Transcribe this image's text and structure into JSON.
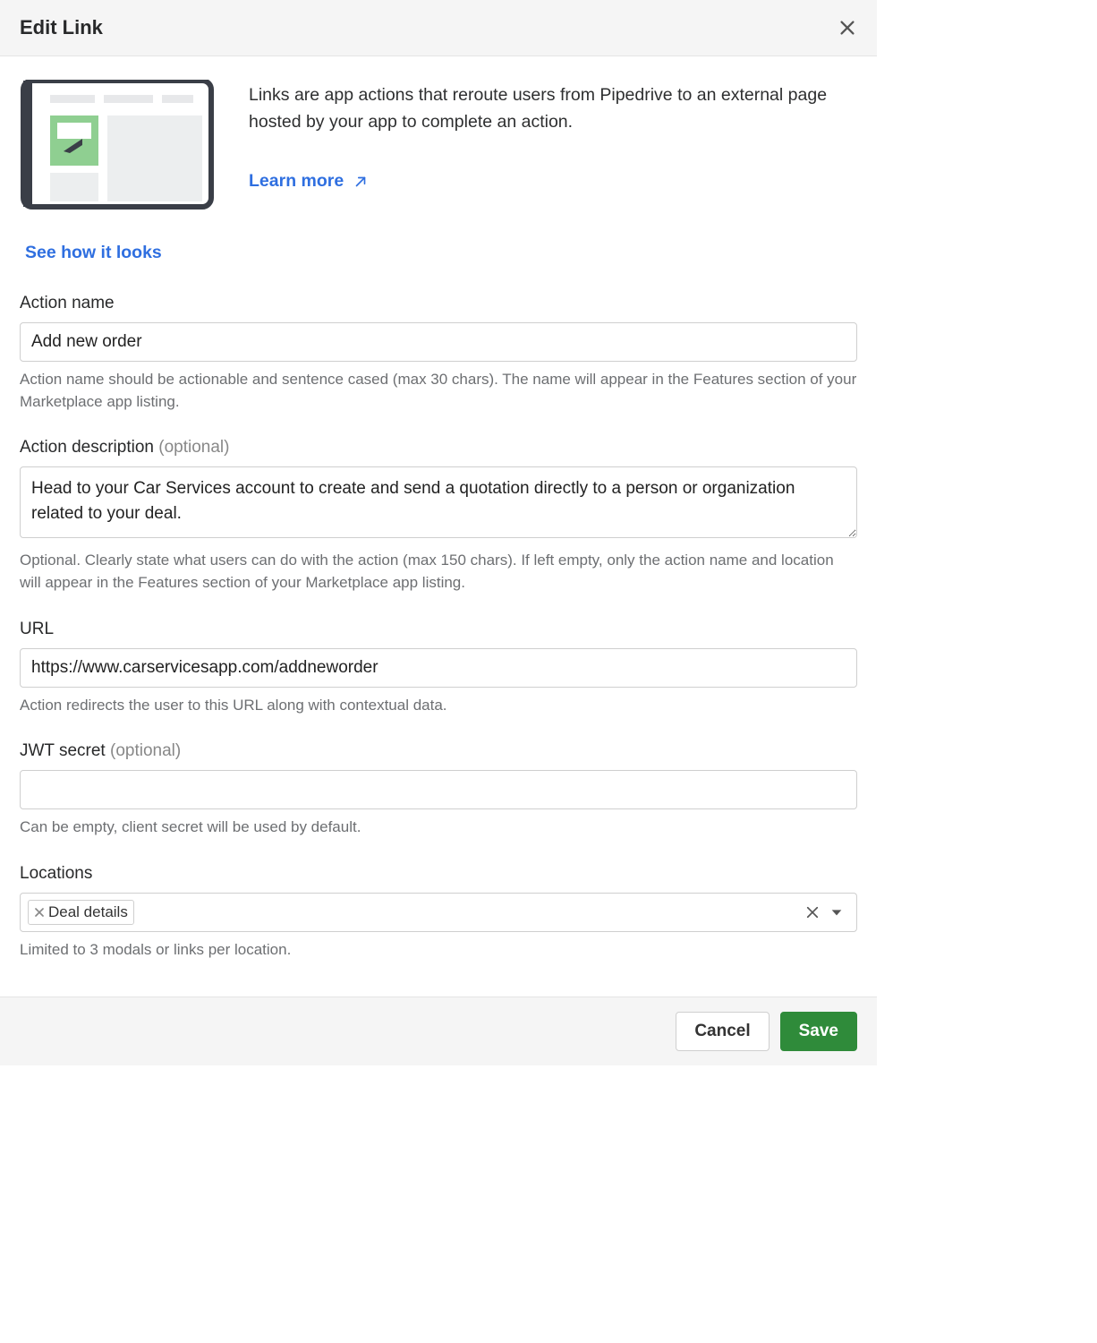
{
  "header": {
    "title": "Edit Link"
  },
  "intro": {
    "description": "Links are app actions that reroute users from Pipedrive to an external page hosted by your app to complete an action.",
    "learn_more": "Learn more",
    "see_how": "See how it looks"
  },
  "fields": {
    "action_name": {
      "label": "Action name",
      "value": "Add new order",
      "help": "Action name should be actionable and sentence cased (max 30 chars). The name will appear in the Features section of your Marketplace app listing."
    },
    "action_description": {
      "label": "Action description ",
      "optional": "(optional)",
      "value": "Head to your Car Services account to create and send a quotation directly to a person or organization related to your deal.",
      "help": "Optional. Clearly state what users can do with the action (max 150 chars). If left empty, only the action name and location will appear in the Features section of your Marketplace app listing."
    },
    "url": {
      "label": "URL",
      "value": "https://www.carservicesapp.com/addneworder",
      "help": "Action redirects the user to this URL along with contextual data."
    },
    "jwt_secret": {
      "label": "JWT secret ",
      "optional": "(optional)",
      "value": "",
      "help": "Can be empty, client secret will be used by default."
    },
    "locations": {
      "label": "Locations",
      "tag": "Deal details",
      "help": "Limited to 3 modals or links per location."
    }
  },
  "footer": {
    "cancel": "Cancel",
    "save": "Save"
  }
}
